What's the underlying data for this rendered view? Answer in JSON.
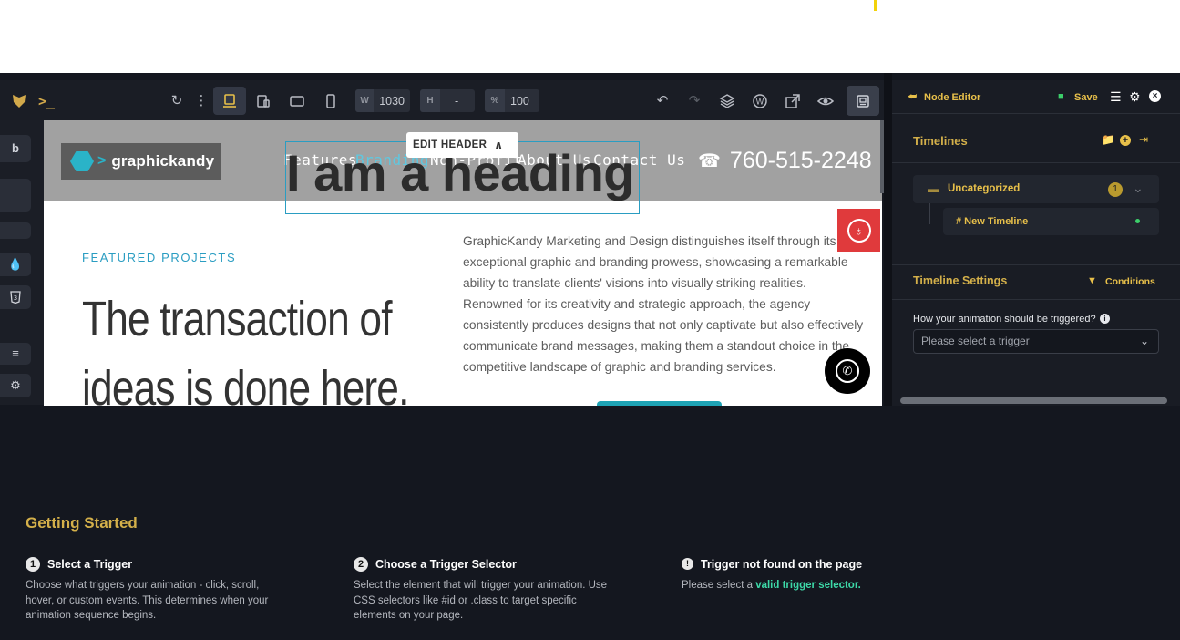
{
  "toolbar": {
    "width_label": "W",
    "width_value": "1030",
    "height_label": "H",
    "height_value": "-",
    "zoom_label": "%",
    "zoom_value": "100"
  },
  "rail": {
    "b_label": "b"
  },
  "site": {
    "logo_text": "graphickandy",
    "nav": [
      "Features",
      "Branding",
      "Non-Profit",
      "About Us",
      "Contact Us"
    ],
    "nav_active": "Branding",
    "phone": "760-515-2248",
    "heading_overlay": "I am a heading",
    "edit_header": "EDIT HEADER",
    "featured_label": "FEATURED PROJECTS",
    "big_heading": "The transaction of ideas is done here.",
    "body_text": "GraphicKandy Marketing and Design distinguishes itself through its exceptional graphic and branding prowess, showcasing a remarkable ability to translate clients' visions into visually striking realities. Renowned for its creativity and strategic approach, the agency consistently produces designs that not only captivate but also effectively communicate brand messages, making them a standout choice in the competitive landscape of graphic and branding services."
  },
  "panel": {
    "title": "Node Editor",
    "save_label": "Save",
    "timelines_title": "Timelines",
    "folder_label": "Uncategorized",
    "folder_count": "1",
    "timeline_item": "# New Timeline",
    "settings_title": "Timeline Settings",
    "conditions_label": "Conditions",
    "trigger_question": "How your animation should be triggered?",
    "trigger_placeholder": "Please select a trigger"
  },
  "getting_started": {
    "title": "Getting Started",
    "steps": [
      {
        "num": "1",
        "title": "Select a Trigger",
        "desc": "Choose what triggers your animation - click, scroll, hover, or custom events. This determines when your animation sequence begins."
      },
      {
        "num": "2",
        "title": "Choose a Trigger Selector",
        "desc": "Select the element that will trigger your animation. Use CSS selectors like #id or .class to target specific elements on your page."
      },
      {
        "num": "!",
        "title": "Trigger not found on the page",
        "desc_prefix": "Please select a ",
        "desc_link": "valid trigger selector."
      }
    ]
  },
  "colors": {
    "accent_gold": "#d4b04a",
    "teal": "#2a9dc2",
    "link_green": "#3dd9a8",
    "accessibility_red": "#e03a3c"
  }
}
